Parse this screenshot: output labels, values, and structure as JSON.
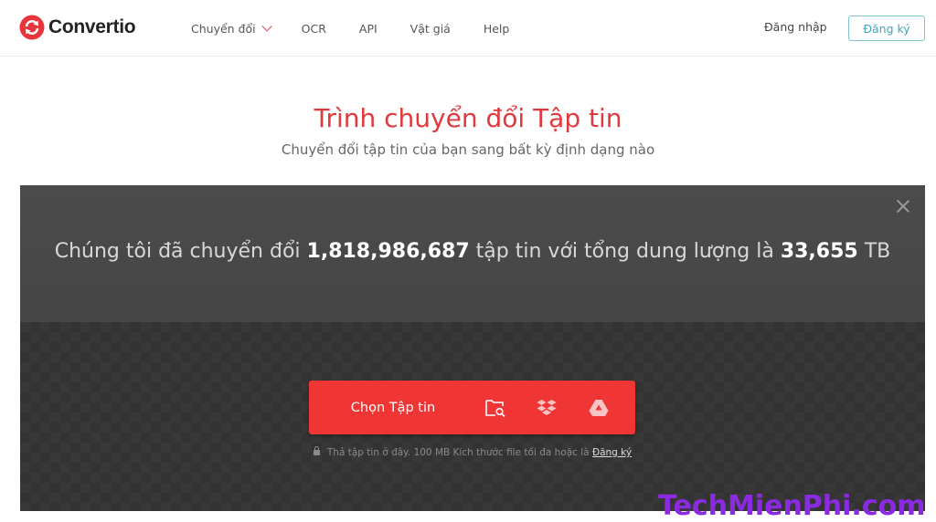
{
  "header": {
    "logo_text": "Convertio",
    "nav": [
      {
        "label": "Chuyển đổi",
        "has_dropdown": true
      },
      {
        "label": "OCR"
      },
      {
        "label": "API"
      },
      {
        "label": "Vật giá"
      },
      {
        "label": "Help"
      }
    ],
    "login_label": "Đăng nhập",
    "signup_label": "Đăng ký"
  },
  "hero": {
    "title": "Trình chuyển đổi Tập tin",
    "subtitle": "Chuyển đổi tập tin của bạn sang bất kỳ định dạng nào"
  },
  "panel": {
    "stats_prefix": "Chúng tôi đã chuyển đổi ",
    "files_count": "1,818,986,687",
    "stats_middle": " tập tin với tổng dung lượng là ",
    "total_size": "33,655",
    "stats_suffix": " TB",
    "choose_files_label": "Chọn Tập tin",
    "sources": [
      "folder-search-icon",
      "dropbox-icon",
      "google-drive-icon"
    ],
    "note_text": "Thả tập tin ở đây. 100 MB Kích thước file tối đa hoặc là ",
    "note_link": "Đăng ký"
  },
  "watermark": "TechMienPhi.com",
  "colors": {
    "brand_red": "#f03535",
    "title_red": "#e0393e",
    "signup_teal": "#3ea8bb",
    "panel_dark": "#3a3a3a",
    "watermark_purple": "#8a2be2"
  }
}
